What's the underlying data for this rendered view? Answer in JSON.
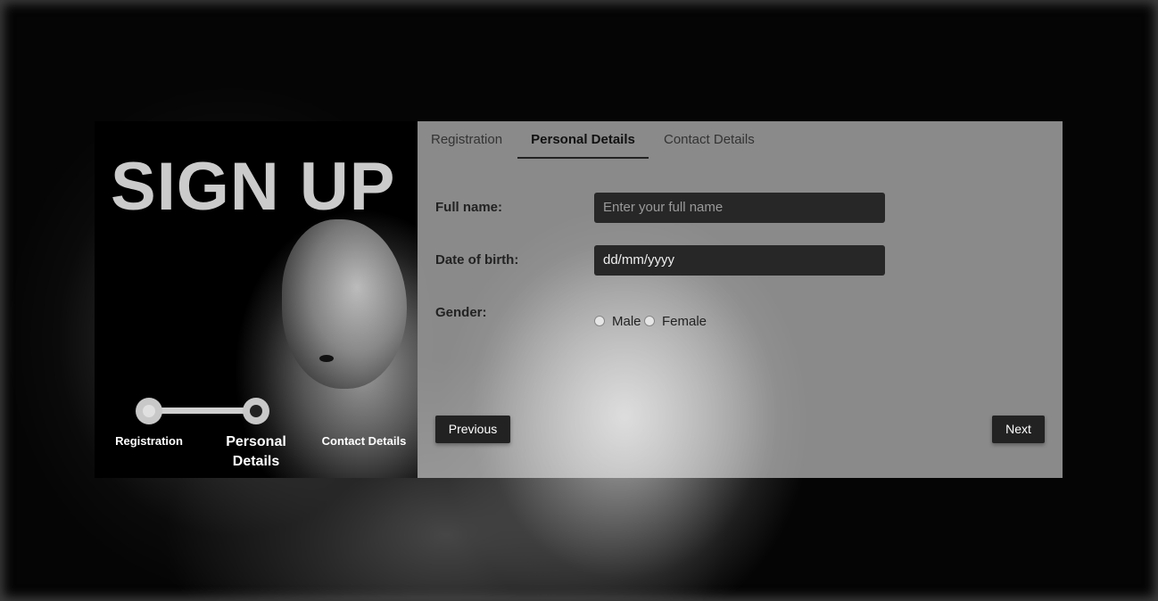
{
  "hero": {
    "title": "SIGN UP"
  },
  "stepper": {
    "steps": [
      {
        "label": "Registration"
      },
      {
        "label_line1": "Personal",
        "label_line2": "Details"
      },
      {
        "label": "Contact Details"
      }
    ],
    "current_step": 2
  },
  "tabs": [
    {
      "label": "Registration"
    },
    {
      "label": "Personal Details"
    },
    {
      "label": "Contact Details"
    }
  ],
  "form": {
    "full_name": {
      "label": "Full name:",
      "placeholder": "Enter your full name",
      "value": ""
    },
    "dob": {
      "label": "Date of birth:",
      "value": "dd/mm/yyyy"
    },
    "gender": {
      "label": "Gender:",
      "options": [
        "Male",
        "Female"
      ]
    }
  },
  "buttons": {
    "previous": "Previous",
    "next": "Next"
  },
  "colors": {
    "button_bg": "#222222",
    "field_bg": "#272727",
    "panel_bg": "#bebebe"
  },
  "icons": {
    "step_indicator": "circle-dot"
  }
}
